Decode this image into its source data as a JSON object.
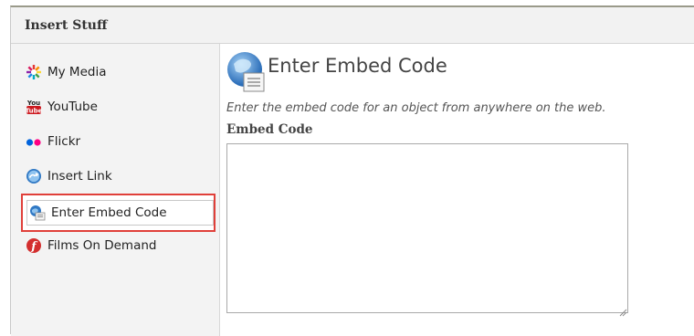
{
  "dialog": {
    "title": "Insert Stuff"
  },
  "sidebar": {
    "items": [
      {
        "label": "My Media",
        "icon": "my-media-icon"
      },
      {
        "label": "YouTube",
        "icon": "youtube-icon"
      },
      {
        "label": "Flickr",
        "icon": "flickr-icon"
      },
      {
        "label": "Insert Link",
        "icon": "insert-link-icon"
      },
      {
        "label": "Enter Embed Code",
        "icon": "embed-code-icon",
        "selected": true
      },
      {
        "label": "Films On Demand",
        "icon": "films-on-demand-icon"
      }
    ]
  },
  "main": {
    "title": "Enter Embed Code",
    "description": "Enter the embed code for an object from anywhere on the web.",
    "field_label": "Embed Code",
    "embed_value": ""
  },
  "colors": {
    "highlight_border": "#e0403a",
    "youtube_red": "#cc181e",
    "flickr_blue": "#0063dc",
    "flickr_pink": "#ff0084"
  }
}
